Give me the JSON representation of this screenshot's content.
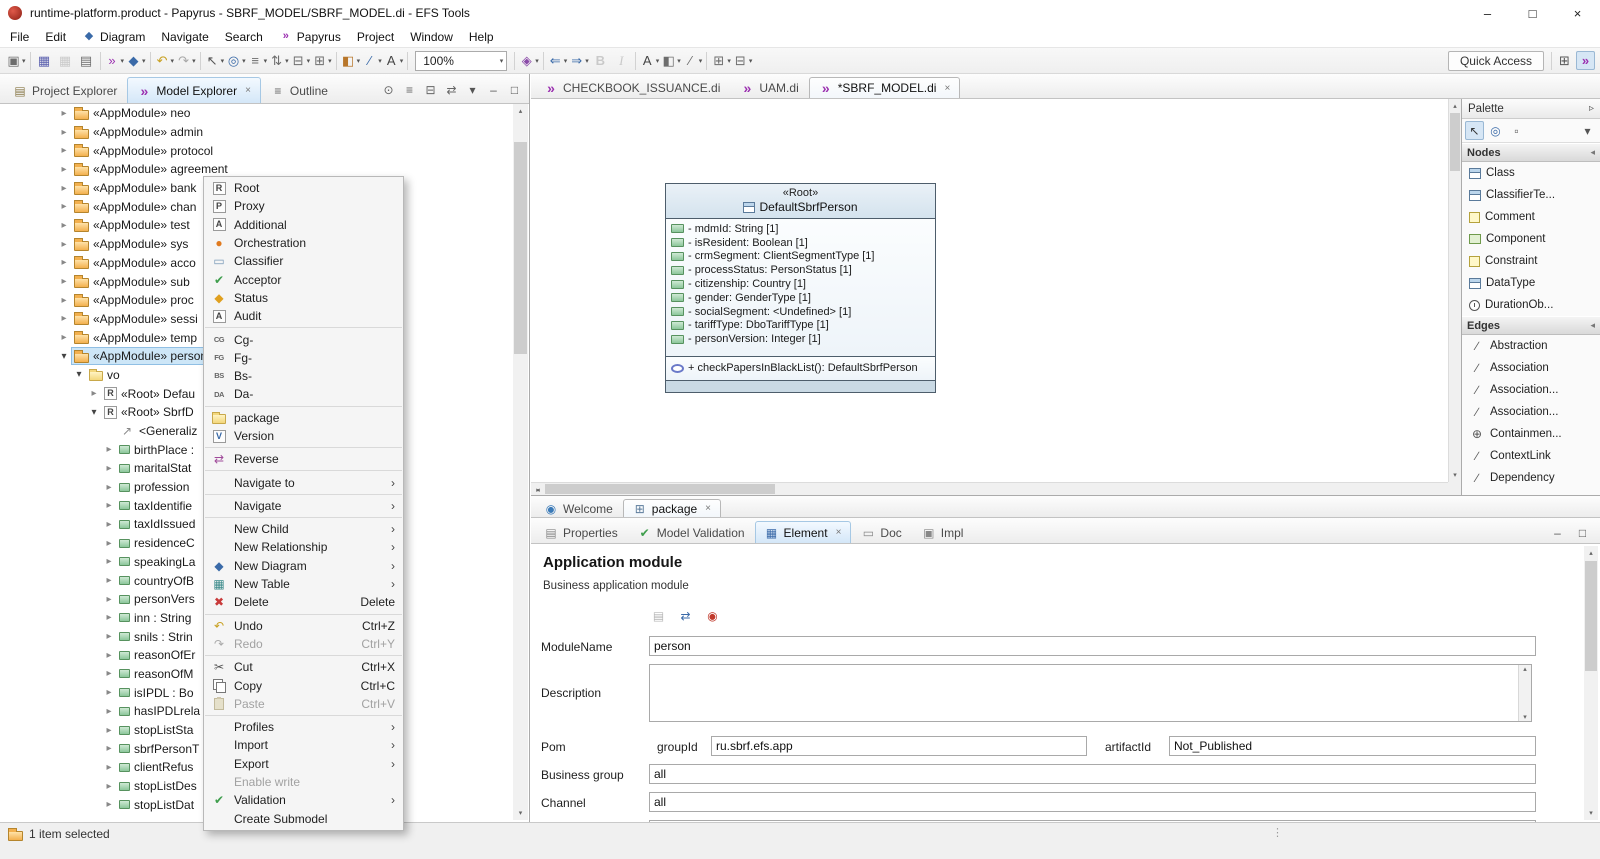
{
  "window": {
    "title": "runtime-platform.product - Papyrus - SBRF_MODEL/SBRF_MODEL.di - EFS Tools",
    "controls": {
      "minimize": "–",
      "maximize": "□",
      "close": "×"
    }
  },
  "menu_bar": {
    "items": [
      {
        "label": "File"
      },
      {
        "label": "Edit"
      },
      {
        "label": "Diagram",
        "icon": "diagram-menu"
      },
      {
        "label": "Navigate"
      },
      {
        "label": "Search"
      },
      {
        "label": "Papyrus",
        "icon": "papyrus-menu"
      },
      {
        "label": "Project"
      },
      {
        "label": "Window"
      },
      {
        "label": "Help"
      }
    ]
  },
  "toolbar": {
    "zoom_value": "100%",
    "quick_access_label": "Quick Access",
    "items": [
      {
        "name": "new-wizard",
        "glyph": "▣",
        "color": "#6d6d6d",
        "dropdown": true
      },
      {
        "sep": true
      },
      {
        "name": "save",
        "glyph": "▦",
        "color": "#5a5fae"
      },
      {
        "name": "save-all",
        "glyph": "▦",
        "color": "#a8a8a8",
        "disabled": true
      },
      {
        "name": "print",
        "glyph": "▤",
        "color": "#6d6d6d"
      },
      {
        "sep": true
      },
      {
        "name": "new-papyrus-model",
        "glyph": "»",
        "color": "#9b30b0",
        "dropdown": true
      },
      {
        "name": "new-diagram",
        "glyph": "◆",
        "color": "#3a6aa8",
        "dropdown": true
      },
      {
        "sep": true
      },
      {
        "name": "undo",
        "glyph": "↶",
        "color": "#c8a020",
        "dropdown": true
      },
      {
        "name": "redo",
        "glyph": "↷",
        "color": "#a8a8a8",
        "dropdown": true
      },
      {
        "sep": true
      },
      {
        "name": "select",
        "glyph": "↖",
        "color": "#555555",
        "dropdown": true
      },
      {
        "name": "zoom",
        "glyph": "◎",
        "color": "#3a6aa8",
        "dropdown": true
      },
      {
        "name": "align",
        "glyph": "≡",
        "color": "#6d6d6d",
        "dropdown": true
      },
      {
        "name": "distribute",
        "glyph": "⇅",
        "color": "#6d6d6d",
        "dropdown": true
      },
      {
        "name": "order",
        "glyph": "⊟",
        "color": "#6d6d6d",
        "dropdown": true
      },
      {
        "name": "grid",
        "glyph": "⊞",
        "color": "#6d6d6d",
        "dropdown": true
      },
      {
        "sep": true
      },
      {
        "name": "fill-color",
        "glyph": "◧",
        "color": "#b8762a",
        "dropdown": true
      },
      {
        "name": "line-color",
        "glyph": "∕",
        "color": "#3a6aa8",
        "dropdown": true
      },
      {
        "name": "font",
        "glyph": "A",
        "color": "#444444",
        "dropdown": true
      },
      {
        "sep": true
      },
      {
        "zoom": true
      },
      {
        "sep": true
      },
      {
        "name": "apply-style",
        "glyph": "◈",
        "color": "#8a4aa8",
        "dropdown": true
      },
      {
        "sep": true
      },
      {
        "name": "arrow-left",
        "glyph": "⇐",
        "color": "#3a6aa8",
        "dropdown": true
      },
      {
        "name": "arrow-right",
        "glyph": "⇒",
        "color": "#3a6aa8",
        "dropdown": true
      },
      {
        "name": "bold",
        "glyph": "B",
        "color": "#a8a8a8",
        "disabled": true
      },
      {
        "name": "italic",
        "glyph": "I",
        "color": "#a8a8a8",
        "disabled": true
      },
      {
        "sep": true
      },
      {
        "name": "font-color",
        "glyph": "A",
        "color": "#444444",
        "dropdown": true
      },
      {
        "name": "fill",
        "glyph": "◧",
        "color": "#6d6d6d",
        "dropdown": true
      },
      {
        "name": "line-style",
        "glyph": "∕",
        "color": "#6d6d6d",
        "dropdown": true
      },
      {
        "sep": true
      },
      {
        "name": "compartments",
        "glyph": "⊞",
        "color": "#6d6d6d",
        "dropdown": true
      },
      {
        "name": "ports",
        "glyph": "⊟",
        "color": "#6d6d6d",
        "dropdown": true
      }
    ],
    "perspectives": [
      {
        "name": "open-perspective",
        "glyph": "⊞",
        "color": "#555555"
      },
      {
        "name": "papyrus-perspective",
        "glyph": "»",
        "color": "#9b30b0",
        "active": true
      }
    ]
  },
  "explorer": {
    "tabs": [
      {
        "label": "Project Explorer",
        "icon": "project-explorer"
      },
      {
        "label": "Model Explorer",
        "icon": "model-explorer",
        "active": true,
        "closable": true
      },
      {
        "label": "Outline",
        "icon": "outline"
      }
    ],
    "tools": [
      "focus",
      "sort",
      "collapse-all",
      "link-with-editor",
      "view-menu",
      "minimize",
      "maximize"
    ],
    "tree": [
      {
        "indent": 1,
        "chevron": "collapsed",
        "icon": "package",
        "label": "«AppModule» neo"
      },
      {
        "indent": 1,
        "chevron": "collapsed",
        "icon": "package",
        "label": "«AppModule» admin"
      },
      {
        "indent": 1,
        "chevron": "collapsed",
        "icon": "package",
        "label": "«AppModule» protocol"
      },
      {
        "indent": 1,
        "chevron": "collapsed",
        "icon": "package",
        "label": "«AppModule» agreement"
      },
      {
        "indent": 1,
        "chevron": "collapsed",
        "icon": "package",
        "label": "«AppModule» bank"
      },
      {
        "indent": 1,
        "chevron": "collapsed",
        "icon": "package",
        "label": "«AppModule» chan"
      },
      {
        "indent": 1,
        "chevron": "collapsed",
        "icon": "package",
        "label": "«AppModule» test"
      },
      {
        "indent": 1,
        "chevron": "collapsed",
        "icon": "package",
        "label": "«AppModule» sys"
      },
      {
        "indent": 1,
        "chevron": "collapsed",
        "icon": "package",
        "label": "«AppModule» acco"
      },
      {
        "indent": 1,
        "chevron": "collapsed",
        "icon": "package",
        "label": "«AppModule» sub"
      },
      {
        "indent": 1,
        "chevron": "collapsed",
        "icon": "package",
        "label": "«AppModule» proc"
      },
      {
        "indent": 1,
        "chevron": "collapsed",
        "icon": "package",
        "label": "«AppModule» sessi"
      },
      {
        "indent": 1,
        "chevron": "collapsed",
        "icon": "package",
        "label": "«AppModule» temp"
      },
      {
        "indent": 1,
        "chevron": "expanded",
        "icon": "package",
        "label": "«AppModule» person",
        "selected": true
      },
      {
        "indent": 2,
        "chevron": "expanded",
        "icon": "folder",
        "label": "vo"
      },
      {
        "indent": 3,
        "chevron": "collapsed",
        "icon": "root",
        "label": "«Root» Defau"
      },
      {
        "indent": 3,
        "chevron": "expanded",
        "icon": "root",
        "label": "«Root» SbrfD"
      },
      {
        "indent": 4,
        "chevron": null,
        "icon": "generalization",
        "label": "<Generaliz"
      },
      {
        "indent": 4,
        "chevron": "collapsed",
        "icon": "property",
        "label": "birthPlace :"
      },
      {
        "indent": 4,
        "chevron": "collapsed",
        "icon": "property",
        "label": "maritalStat"
      },
      {
        "indent": 4,
        "chevron": "collapsed",
        "icon": "property",
        "label": "profession"
      },
      {
        "indent": 4,
        "chevron": "collapsed",
        "icon": "property",
        "label": "taxIdentifie"
      },
      {
        "indent": 4,
        "chevron": "collapsed",
        "icon": "property",
        "label": "taxIdIssued"
      },
      {
        "indent": 4,
        "chevron": "collapsed",
        "icon": "property",
        "label": "residenceC"
      },
      {
        "indent": 4,
        "chevron": "collapsed",
        "icon": "property",
        "label": "speakingLa"
      },
      {
        "indent": 4,
        "chevron": "collapsed",
        "icon": "property",
        "label": "countryOfB"
      },
      {
        "indent": 4,
        "chevron": "collapsed",
        "icon": "property",
        "label": "personVers"
      },
      {
        "indent": 4,
        "chevron": "collapsed",
        "icon": "property",
        "label": "inn : String"
      },
      {
        "indent": 4,
        "chevron": "collapsed",
        "icon": "property",
        "label": "snils : Strin"
      },
      {
        "indent": 4,
        "chevron": "collapsed",
        "icon": "property",
        "label": "reasonOfEr"
      },
      {
        "indent": 4,
        "chevron": "collapsed",
        "icon": "property",
        "label": "reasonOfM"
      },
      {
        "indent": 4,
        "chevron": "collapsed",
        "icon": "property",
        "label": "isIPDL : Bo"
      },
      {
        "indent": 4,
        "chevron": "collapsed",
        "icon": "property",
        "label": "hasIPDLrela"
      },
      {
        "indent": 4,
        "chevron": "collapsed",
        "icon": "property",
        "label": "stopListSta"
      },
      {
        "indent": 4,
        "chevron": "collapsed",
        "icon": "property",
        "label": "sbrfPersonT"
      },
      {
        "indent": 4,
        "chevron": "collapsed",
        "icon": "property",
        "label": "clientRefus"
      },
      {
        "indent": 4,
        "chevron": "collapsed",
        "icon": "property",
        "label": "stopListDes"
      },
      {
        "indent": 4,
        "chevron": "collapsed",
        "icon": "property",
        "label": "stopListDat"
      }
    ]
  },
  "context_menu": {
    "items": [
      {
        "icon": "root",
        "label": "Root"
      },
      {
        "icon": "proxy",
        "label": "Proxy"
      },
      {
        "icon": "additional",
        "label": "Additional"
      },
      {
        "icon": "orchestration",
        "label": "Orchestration"
      },
      {
        "icon": "classifier",
        "label": "Classifier"
      },
      {
        "icon": "acceptor",
        "label": "Acceptor"
      },
      {
        "icon": "status",
        "label": "Status"
      },
      {
        "icon": "audit",
        "label": "Audit"
      },
      {
        "separator": true
      },
      {
        "icon": "cg",
        "label": "Cg-"
      },
      {
        "icon": "fg",
        "label": "Fg-"
      },
      {
        "icon": "bs",
        "label": "Bs-"
      },
      {
        "icon": "da",
        "label": "Da-"
      },
      {
        "separator": true
      },
      {
        "icon": "folder",
        "label": "package"
      },
      {
        "icon": "version",
        "label": "Version"
      },
      {
        "separator": true
      },
      {
        "icon": "reverse",
        "label": "Reverse"
      },
      {
        "separator": true
      },
      {
        "label": "Navigate to",
        "submenu": true
      },
      {
        "separator": true
      },
      {
        "label": "Navigate",
        "submenu": true
      },
      {
        "separator": true
      },
      {
        "label": "New Child",
        "submenu": true
      },
      {
        "label": "New Relationship",
        "submenu": true
      },
      {
        "icon": "new-diagram",
        "label": "New Diagram",
        "submenu": true
      },
      {
        "icon": "new-table",
        "label": "New Table",
        "submenu": true
      },
      {
        "icon": "delete",
        "label": "Delete",
        "shortcut": "Delete"
      },
      {
        "separator": true
      },
      {
        "icon": "undo",
        "label": "Undo",
        "shortcut": "Ctrl+Z"
      },
      {
        "icon": "redo",
        "label": "Redo",
        "shortcut": "Ctrl+Y",
        "disabled": true
      },
      {
        "separator": true
      },
      {
        "icon": "cut",
        "label": "Cut",
        "shortcut": "Ctrl+X"
      },
      {
        "icon": "copy",
        "label": "Copy",
        "shortcut": "Ctrl+C"
      },
      {
        "icon": "paste",
        "label": "Paste",
        "shortcut": "Ctrl+V",
        "disabled": true
      },
      {
        "separator": true
      },
      {
        "label": "Profiles",
        "submenu": true
      },
      {
        "label": "Import",
        "submenu": true
      },
      {
        "label": "Export",
        "submenu": true
      },
      {
        "label": "Enable write",
        "disabled": true
      },
      {
        "icon": "validation",
        "label": "Validation",
        "submenu": true
      },
      {
        "label": "Create Submodel"
      }
    ]
  },
  "editor": {
    "tabs": [
      {
        "label": "CHECKBOOK_ISSUANCE.di",
        "icon": "papyrus-model"
      },
      {
        "label": "UAM.di",
        "icon": "papyrus-model"
      },
      {
        "label": "*SBRF_MODEL.di",
        "icon": "papyrus-model",
        "active": true,
        "closable": true
      }
    ],
    "sub_tabs": [
      {
        "label": "Welcome",
        "icon": "welcome"
      },
      {
        "label": "package",
        "icon": "package-diagram",
        "active": true,
        "closable": true
      }
    ]
  },
  "diagram": {
    "class": {
      "stereotype": "«Root»",
      "name": "DefaultSbrfPerson",
      "attributes": [
        "- mdmId: String [1]",
        "- isResident: Boolean [1]",
        "- crmSegment: ClientSegmentType [1]",
        "- processStatus: PersonStatus [1]",
        "- citizenship: Country [1]",
        "- gender: GenderType [1]",
        "- socialSegment: <Undefined> [1]",
        "- tariffType: DboTariffType [1]",
        "- personVersion: Integer [1]"
      ],
      "operations": [
        "+ checkPapersInBlackList(): DefaultSbrfPerson"
      ]
    }
  },
  "palette": {
    "title": "Palette",
    "tools": [
      {
        "name": "select-tool",
        "active": true
      },
      {
        "name": "zoom-tool"
      },
      {
        "name": "marquee-tool"
      },
      {
        "name": "palette-menu",
        "align": "right"
      }
    ],
    "sections": [
      {
        "label": "Nodes",
        "items": [
          {
            "icon": "class",
            "label": "Class"
          },
          {
            "icon": "classifier-template",
            "label": "ClassifierTe..."
          },
          {
            "icon": "comment",
            "label": "Comment"
          },
          {
            "icon": "component",
            "label": "Component"
          },
          {
            "icon": "constraint",
            "label": "Constraint"
          },
          {
            "icon": "datatype",
            "label": "DataType"
          },
          {
            "icon": "duration-observation",
            "label": "DurationOb..."
          }
        ]
      },
      {
        "label": "Edges",
        "items": [
          {
            "icon": "abstraction",
            "label": "Abstraction"
          },
          {
            "icon": "association",
            "label": "Association"
          },
          {
            "icon": "association-branch",
            "label": "Association..."
          },
          {
            "icon": "association-class",
            "label": "Association..."
          },
          {
            "icon": "containment",
            "label": "Containmen..."
          },
          {
            "icon": "contextlink",
            "label": "ContextLink"
          },
          {
            "icon": "dependency",
            "label": "Dependency"
          }
        ]
      }
    ]
  },
  "properties": {
    "tabs": [
      {
        "label": "Properties",
        "icon": "properties"
      },
      {
        "label": "Model Validation",
        "icon": "model-validation"
      },
      {
        "label": "Element",
        "icon": "element",
        "active": true,
        "closable": true
      },
      {
        "label": "Doc",
        "icon": "doc"
      },
      {
        "label": "Impl",
        "icon": "impl"
      }
    ],
    "tools": [
      "show-doc",
      "show-advanced",
      "pin"
    ],
    "heading": "Application module",
    "subheading": "Business application module",
    "fields": {
      "module_name": {
        "label": "ModuleName",
        "value": "person"
      },
      "description": {
        "label": "Description",
        "value": ""
      },
      "pom": {
        "label": "Pom",
        "group_id_label": "groupId",
        "group_id_value": "ru.sbrf.efs.app",
        "artifact_id_label": "artifactId",
        "artifact_id_value": "Not_Published"
      },
      "business_group": {
        "label": "Business group",
        "value": "all"
      },
      "channel": {
        "label": "Channel",
        "value": "all"
      }
    }
  },
  "status_bar": {
    "text": "1 item selected"
  }
}
